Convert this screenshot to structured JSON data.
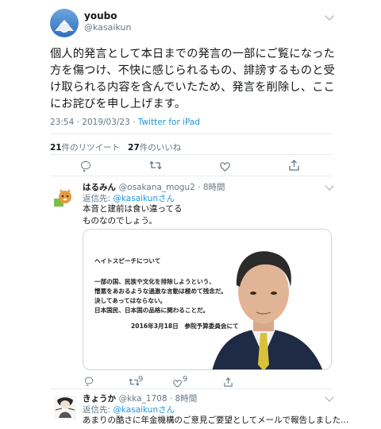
{
  "main": {
    "display_name": "youbo",
    "handle": "@kasaikun",
    "text": "個人的発言として本日までの発言の一部にご覧になった方を傷つけ、不快に感じられるもの、誹謗するものと受け取られる内容を含んでいたため、発言を削除し、ここにお詫びを申し上げます。",
    "timestamp": "23:54 · 2019/03/23 · ",
    "client": "Twitter for iPad",
    "retweet_count": "21",
    "retweet_label": "件のリツイート",
    "like_count": "27",
    "like_label": "件のいいね"
  },
  "replies": [
    {
      "display_name": "はるみん",
      "handle_time": "@osakana_mogu2 · 8時間",
      "reply_to_label": "返信先: ",
      "reply_to_mention": "@kasaikunさん",
      "text_line1": "本音と建前は食い違ってる",
      "text_line2": "ものなのでしょう。",
      "card": {
        "heading": "ヘイトスピーチについて",
        "line1": "一部の国、民族や文化を排除しようという、",
        "line2": "憎悪をあおるような過激な言動は極めて残念だ。",
        "line3": "決してあってはならない。",
        "line4": "日本国民、日本国の品格に関わることだ。",
        "source": "2016年3月18日　参院予算委員会にて"
      },
      "retweet_count": "9",
      "like_count": "9"
    },
    {
      "display_name": "きょうか",
      "handle_time": "@kka_1708 · 8時間",
      "reply_to_label": "返信先: ",
      "reply_to_mention": "@kasaikunさん",
      "text_line1": "あまりの酷さに年金機構のご意見ご要望としてメールで報告しました..."
    }
  ],
  "colors": {
    "link": "#1b95e0",
    "muted": "#657786",
    "border": "#e6ecf0"
  }
}
